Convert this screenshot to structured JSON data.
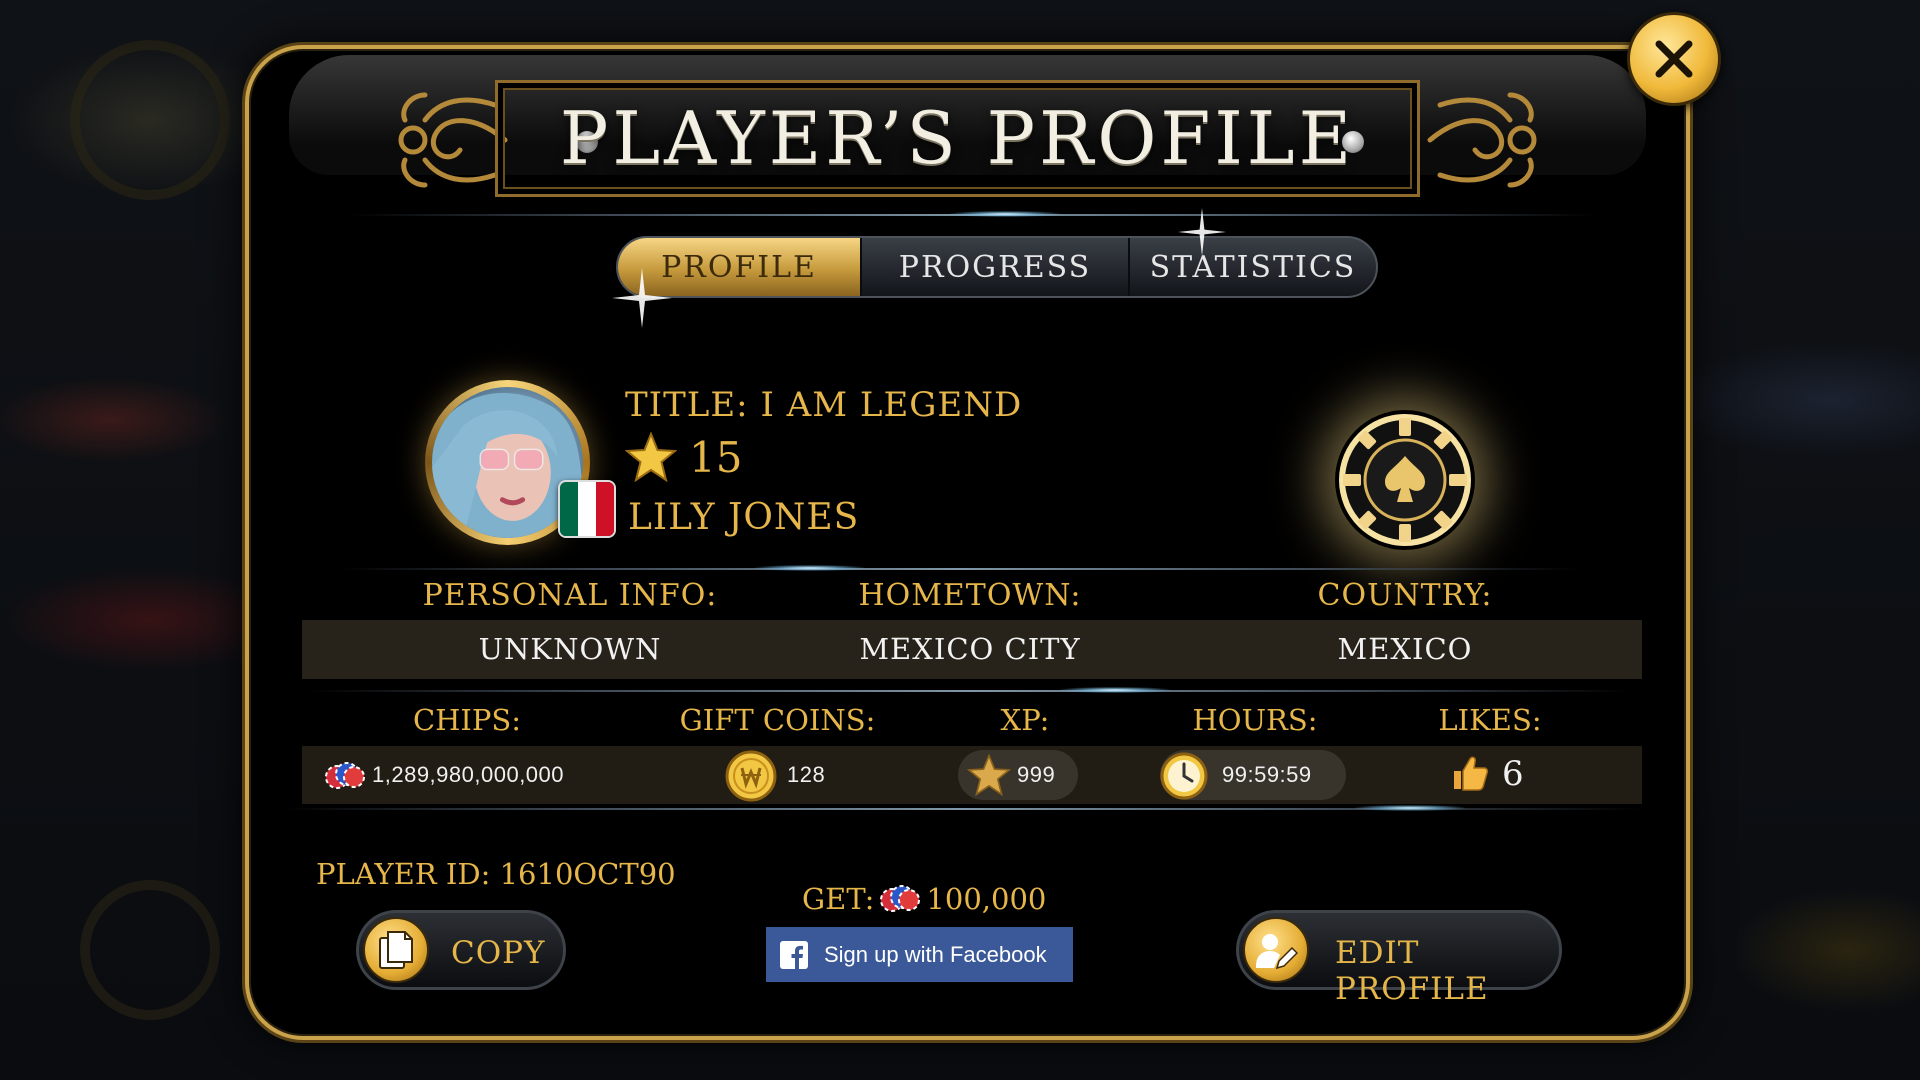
{
  "header": {
    "title": "PLAYER’S PROFILE"
  },
  "tabs": [
    {
      "label": "PROFILE",
      "active": true
    },
    {
      "label": "PROGRESS",
      "active": false
    },
    {
      "label": "STATISTICS",
      "active": false
    }
  ],
  "profile": {
    "title": "TITLE: I AM LEGEND",
    "level": "15",
    "name": "LILY JONES",
    "flag_colors": [
      "#006847",
      "#ffffff",
      "#ce1126"
    ]
  },
  "info": {
    "personal_label": "PERSONAL INFO:",
    "personal_value": "UNKNOWN",
    "hometown_label": "HOMETOWN:",
    "hometown_value": "MEXICO CITY",
    "country_label": "COUNTRY:",
    "country_value": "MEXICO"
  },
  "stats": {
    "chips_label": "CHIPS:",
    "chips_value": "1,289,980,000,000",
    "gift_label": "GIFT COINS:",
    "gift_value": "128",
    "xp_label": "XP:",
    "xp_value": "999",
    "hours_label": "HOURS:",
    "hours_value": "99:59:59",
    "likes_label": "LIKES:",
    "likes_value": "6"
  },
  "footer": {
    "player_id": "PLAYER ID: 1610OCT90",
    "copy_label": "COPY",
    "get_label": "GET:",
    "get_value": "100,000",
    "facebook_label": "Sign up with Facebook",
    "edit_label": "EDIT PROFILE"
  },
  "colors": {
    "gold": "#e6b64a",
    "facebook": "#3b5998",
    "panel": "#000000"
  }
}
